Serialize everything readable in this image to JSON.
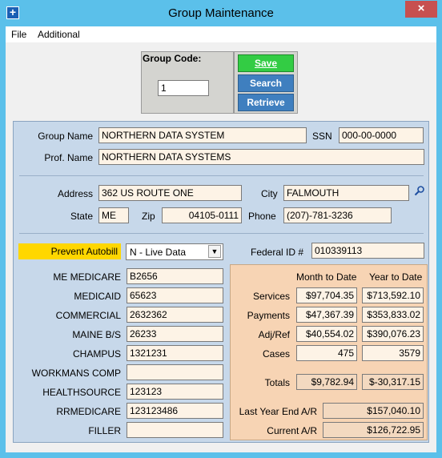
{
  "window": {
    "title": "Group Maintenance",
    "close": "×"
  },
  "menu": {
    "file": "File",
    "additional": "Additional"
  },
  "group_code": {
    "label": "Group Code:",
    "value": "1"
  },
  "buttons": {
    "save": "Save",
    "search": "Search",
    "retrieve": "Retrieve"
  },
  "fields": {
    "group_name_label": "Group Name",
    "group_name": "NORTHERN DATA SYSTEM",
    "ssn_label": "SSN",
    "ssn": "000-00-0000",
    "prof_name_label": "Prof. Name",
    "prof_name": "NORTHERN DATA SYSTEMS",
    "address_label": "Address",
    "address": "362 US ROUTE ONE",
    "city_label": "City",
    "city": "FALMOUTH",
    "state_label": "State",
    "state": "ME",
    "zip_label": "Zip",
    "zip": "04105-0111",
    "phone_label": "Phone",
    "phone": "(207)-781-3236",
    "prevent_autobill_label": "Prevent Autobill",
    "prevent_autobill": "N - Live Data",
    "federal_id_label": "Federal ID #",
    "federal_id": "010339113"
  },
  "payers": [
    {
      "label": "ME MEDICARE",
      "value": "B2656"
    },
    {
      "label": "MEDICAID",
      "value": "65623"
    },
    {
      "label": "COMMERCIAL",
      "value": "2632362"
    },
    {
      "label": "MAINE B/S",
      "value": "26233"
    },
    {
      "label": "CHAMPUS",
      "value": "1321231"
    },
    {
      "label": "WORKMANS COMP",
      "value": ""
    },
    {
      "label": "HEALTHSOURCE",
      "value": "123123"
    },
    {
      "label": "RRMEDICARE",
      "value": "123123486"
    },
    {
      "label": "FILLER",
      "value": ""
    }
  ],
  "stats": {
    "month_header": "Month to Date",
    "year_header": "Year to Date",
    "rows": [
      {
        "label": "Services",
        "month": "$97,704.35",
        "year": "$713,592.10"
      },
      {
        "label": "Payments",
        "month": "$47,367.39",
        "year": "$353,833.02"
      },
      {
        "label": "Adj/Ref",
        "month": "$40,554.02",
        "year": "$390,076.23"
      },
      {
        "label": "Cases",
        "month": "475",
        "year": "3579"
      }
    ],
    "totals_label": "Totals",
    "totals_month": "$9,782.94",
    "totals_year": "$-30,317.15",
    "last_year_label": "Last Year End A/R",
    "last_year": "$157,040.10",
    "current_label": "Current A/R",
    "current": "$126,722.95"
  }
}
